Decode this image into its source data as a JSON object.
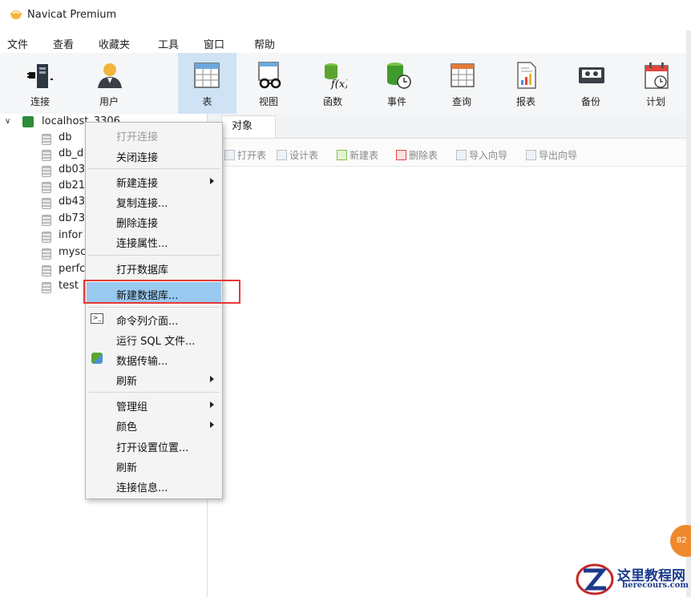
{
  "app": {
    "title": "Navicat Premium"
  },
  "menu": [
    "文件",
    "查看",
    "收藏夹",
    "工具",
    "窗口",
    "帮助"
  ],
  "toolbar": {
    "items": [
      {
        "label": "连接",
        "icon": "connection-plug-icon"
      },
      {
        "label": "用户",
        "icon": "user-icon"
      },
      {
        "label": "表",
        "icon": "table-icon",
        "active": true
      },
      {
        "label": "视图",
        "icon": "view-glasses-icon"
      },
      {
        "label": "函数",
        "icon": "function-icon"
      },
      {
        "label": "事件",
        "icon": "event-clock-icon"
      },
      {
        "label": "查询",
        "icon": "query-icon"
      },
      {
        "label": "报表",
        "icon": "report-icon"
      },
      {
        "label": "备份",
        "icon": "backup-icon"
      },
      {
        "label": "计划",
        "icon": "schedule-calendar-icon"
      }
    ]
  },
  "sidebar": {
    "connection": "localhost_3306",
    "databases": [
      "db",
      "db_d",
      "db03",
      "db21",
      "db43",
      "db73",
      "infor",
      "mysc",
      "perfc",
      "test"
    ]
  },
  "tabs": {
    "objects": "对象"
  },
  "object_toolbar": [
    "打开表",
    "设计表",
    "新建表",
    "删除表",
    "导入向导",
    "导出向导"
  ],
  "context_menu": {
    "items": [
      {
        "label": "打开连接",
        "disabled": true
      },
      {
        "label": "关闭连接"
      },
      {
        "label": "新建连接",
        "submenu": true
      },
      {
        "label": "复制连接..."
      },
      {
        "label": "删除连接"
      },
      {
        "label": "连接属性..."
      },
      {
        "label": "打开数据库"
      },
      {
        "label": "新建数据库...",
        "highlighted": true
      },
      {
        "label": "命令列介面...",
        "icon": "terminal-icon"
      },
      {
        "label": "运行 SQL 文件..."
      },
      {
        "label": "数据传输...",
        "icon": "data-transfer-icon"
      },
      {
        "label": "刷新",
        "submenu": true
      },
      {
        "label": "管理组",
        "submenu": true
      },
      {
        "label": "颜色",
        "submenu": true
      },
      {
        "label": "打开设置位置..."
      },
      {
        "label": "刷新"
      },
      {
        "label": "连接信息..."
      }
    ]
  },
  "badge": {
    "text": "82"
  },
  "watermark": {
    "title": "这里教程网",
    "url": "herecours.com"
  },
  "colors": {
    "highlight": "#99c9ef",
    "redbox": "#e53935",
    "active_tool": "#cfe3f5",
    "orange": "#f0892e"
  }
}
